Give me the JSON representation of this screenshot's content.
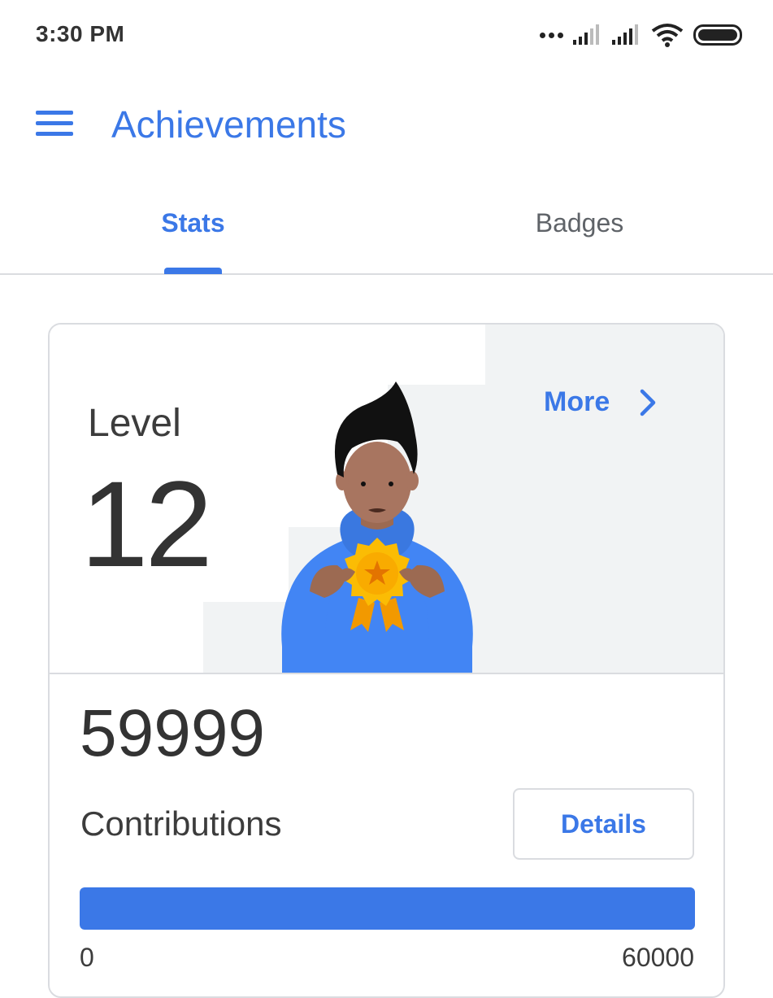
{
  "status_bar": {
    "time": "3:30 PM",
    "icons": [
      "more-dots-icon",
      "signal-icon",
      "signal-icon",
      "wifi-icon",
      "battery-icon"
    ]
  },
  "app_bar": {
    "title": "Achievements",
    "menu_icon": "menu-icon"
  },
  "tabs": [
    {
      "label": "Stats",
      "selected": true
    },
    {
      "label": "Badges",
      "selected": false
    }
  ],
  "level_card": {
    "level_label": "Level",
    "level_value": "12",
    "more_label": "More",
    "contributions_value": "59999",
    "contributions_label": "Contributions",
    "details_label": "Details",
    "progress": {
      "min_label": "0",
      "max_label": "60000",
      "value": 59999,
      "max": 60000
    }
  },
  "colors": {
    "accent": "#3b78e7",
    "text": "#3c3c3c",
    "divider": "#dadce0",
    "stairs": "#f1f3f4",
    "badge": "#fbbc04"
  }
}
